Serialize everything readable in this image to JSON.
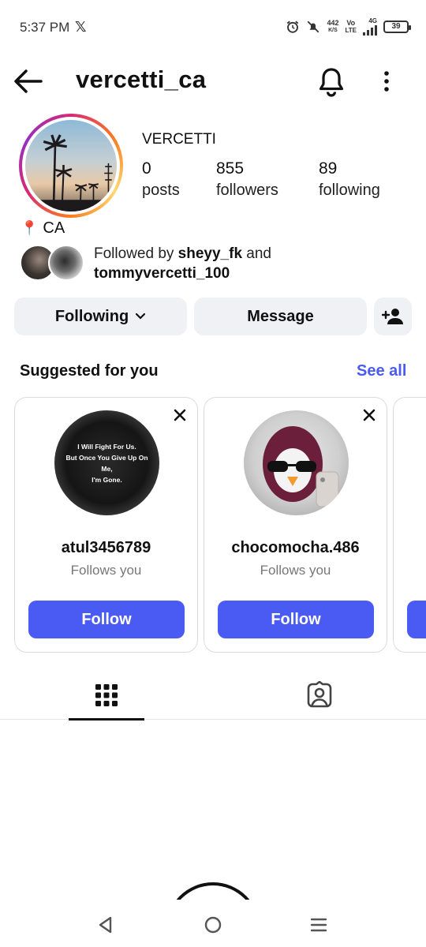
{
  "status_bar": {
    "time": "5:37 PM",
    "app_icon": "x-icon",
    "net_speed_value": "442",
    "net_speed_unit": "K/S",
    "volte_top": "Vo",
    "volte_bottom": "LTE",
    "network_type": "4G",
    "battery": "39"
  },
  "header": {
    "title": "vercetti_ca",
    "back_icon": "arrow-left-icon",
    "bell_icon": "bell-icon",
    "more_icon": "more-vertical-icon"
  },
  "profile": {
    "display_name": "VERCETTI",
    "stats": [
      {
        "value": "0",
        "label": "posts"
      },
      {
        "value": "855",
        "label": "followers"
      },
      {
        "value": "89",
        "label": "following"
      }
    ],
    "location_pin": "📍",
    "location": "CA",
    "followed_by_prefix": "Followed by ",
    "followed_by_user1": "sheyy_fk",
    "followed_by_and": " and",
    "followed_by_user2": "tommyvercetti_100"
  },
  "actions": {
    "following_label": "Following",
    "message_label": "Message",
    "add_user_icon": "add-user-icon"
  },
  "suggested": {
    "title": "Suggested for you",
    "see_all": "See all",
    "cards": [
      {
        "username": "atul3456789",
        "subtitle": "Follows you",
        "button": "Follow",
        "avatar_text_1": "I Will Fight For Us.",
        "avatar_text_2": "But Once You Give Up On Me,",
        "avatar_text_3": "I'm Gone."
      },
      {
        "username": "chocomocha.486",
        "subtitle": "Follows you",
        "button": "Follow"
      }
    ]
  },
  "tabs": {
    "grid_icon": "grid-icon",
    "tagged_icon": "tagged-person-icon"
  },
  "colors": {
    "accent": "#4a5bf3",
    "button_gray": "#eff1f5"
  }
}
